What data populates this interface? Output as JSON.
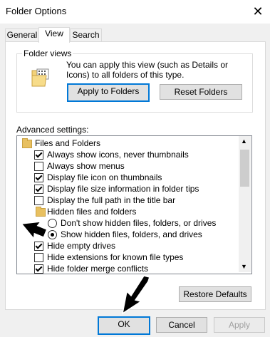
{
  "window": {
    "title": "Folder Options"
  },
  "tabs": [
    {
      "label": "General"
    },
    {
      "label": "View"
    },
    {
      "label": "Search"
    }
  ],
  "folder_views": {
    "group_label": "Folder views",
    "description": "You can apply this view (such as Details or Icons) to all folders of this type.",
    "apply_button": "Apply to Folders",
    "reset_button": "Reset Folders"
  },
  "advanced": {
    "label": "Advanced settings:",
    "items": [
      {
        "kind": "folder",
        "label": "Files and Folders"
      },
      {
        "kind": "checkbox",
        "checked": true,
        "label": "Always show icons, never thumbnails"
      },
      {
        "kind": "checkbox",
        "checked": false,
        "label": "Always show menus"
      },
      {
        "kind": "checkbox",
        "checked": true,
        "label": "Display file icon on thumbnails"
      },
      {
        "kind": "checkbox",
        "checked": true,
        "label": "Display file size information in folder tips"
      },
      {
        "kind": "checkbox",
        "checked": false,
        "label": "Display the full path in the title bar"
      },
      {
        "kind": "folder",
        "label": "Hidden files and folders"
      },
      {
        "kind": "radio",
        "checked": false,
        "label": "Don't show hidden files, folders, or drives"
      },
      {
        "kind": "radio",
        "checked": true,
        "label": "Show hidden files, folders, and drives"
      },
      {
        "kind": "checkbox",
        "checked": true,
        "label": "Hide empty drives"
      },
      {
        "kind": "checkbox",
        "checked": false,
        "label": "Hide extensions for known file types"
      },
      {
        "kind": "checkbox",
        "checked": true,
        "label": "Hide folder merge conflicts"
      }
    ],
    "restore_button": "Restore Defaults"
  },
  "footer": {
    "ok": "OK",
    "cancel": "Cancel",
    "apply": "Apply"
  },
  "icons": {
    "close": "close-icon",
    "folder": "folder-icon",
    "pointer": "black-arrow-pointer"
  }
}
